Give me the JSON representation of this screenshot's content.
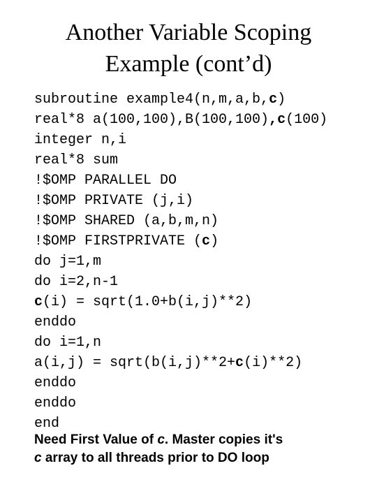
{
  "slide": {
    "title_lines": [
      "Another Variable Scoping",
      "Example (cont’d)"
    ],
    "title_text": "Another Variable Scoping Example (cont’d)",
    "background_color": "#ffffff",
    "text_color": "#000000"
  },
  "code": {
    "language": "Fortran / OpenMP",
    "lines": [
      {
        "plain": "subroutine example4(n,m,a,b,c)",
        "segments": [
          {
            "t": "subroutine example4(n,m,a,b,",
            "b": false
          },
          {
            "t": "c",
            "b": true
          },
          {
            "t": ")",
            "b": false
          }
        ]
      },
      {
        "plain": "real*8 a(100,100),B(100,100),c(100)",
        "segments": [
          {
            "t": "real*8 a(100,100),B(100,100)",
            "b": false
          },
          {
            "t": ",c",
            "b": true
          },
          {
            "t": "(100)",
            "b": false
          }
        ]
      },
      {
        "plain": "integer n,i",
        "segments": [
          {
            "t": "integer n,i",
            "b": false
          }
        ]
      },
      {
        "plain": "real*8 sum",
        "segments": [
          {
            "t": "real*8 sum",
            "b": false
          }
        ]
      },
      {
        "plain": "!$OMP PARALLEL DO",
        "segments": [
          {
            "t": "!$OMP PARALLEL DO",
            "b": false
          }
        ]
      },
      {
        "plain": "!$OMP PRIVATE (j,i)",
        "segments": [
          {
            "t": "!$OMP PRIVATE (j,i)",
            "b": false
          }
        ]
      },
      {
        "plain": "!$OMP SHARED (a,b,m,n)",
        "segments": [
          {
            "t": "!$OMP SHARED (a,b,m,n)",
            "b": false
          }
        ]
      },
      {
        "plain": "!$OMP FIRSTPRIVATE (c)",
        "segments": [
          {
            "t": "!$OMP FIRSTPRIVATE (",
            "b": false
          },
          {
            "t": "c",
            "b": true
          },
          {
            "t": ")",
            "b": false
          }
        ]
      },
      {
        "plain": "do j=1,m",
        "segments": [
          {
            "t": "do j=1,m",
            "b": false
          }
        ]
      },
      {
        "plain": "do i=2,n-1",
        "segments": [
          {
            "t": "do i=2,n-1",
            "b": false
          }
        ]
      },
      {
        "plain": "c(i) = sqrt(1.0+b(i,j)**2)",
        "segments": [
          {
            "t": "c",
            "b": true
          },
          {
            "t": "(i) = sqrt(1.0+b(i,j)**2)",
            "b": false
          }
        ]
      },
      {
        "plain": "enddo",
        "segments": [
          {
            "t": "enddo",
            "b": false
          }
        ]
      },
      {
        "plain": "do i=1,n",
        "segments": [
          {
            "t": "do i=1,n",
            "b": false
          }
        ]
      },
      {
        "plain": "a(i,j) = sqrt(b(i,j)**2+c(i)**2)",
        "segments": [
          {
            "t": "a(i,j) = sqrt(b(i,j)**2+",
            "b": false
          },
          {
            "t": "c",
            "b": true
          },
          {
            "t": "(i)**2)",
            "b": false
          }
        ]
      },
      {
        "plain": "enddo",
        "segments": [
          {
            "t": "enddo",
            "b": false
          }
        ]
      },
      {
        "plain": "enddo",
        "segments": [
          {
            "t": "enddo",
            "b": false
          }
        ]
      },
      {
        "plain": "end",
        "segments": [
          {
            "t": "end",
            "b": false
          }
        ]
      }
    ]
  },
  "caption": {
    "full_text": "Need First Value of c. Master copies it's c array to all threads prior to DO loop",
    "lines": [
      {
        "segments": [
          {
            "t": "Need First Value of ",
            "i": false
          },
          {
            "t": "c",
            "i": true
          },
          {
            "t": ". Master copies it's",
            "i": false
          }
        ]
      },
      {
        "segments": [
          {
            "t": "c",
            "i": true
          },
          {
            "t": " array to all threads prior to DO loop",
            "i": false
          }
        ]
      }
    ]
  }
}
